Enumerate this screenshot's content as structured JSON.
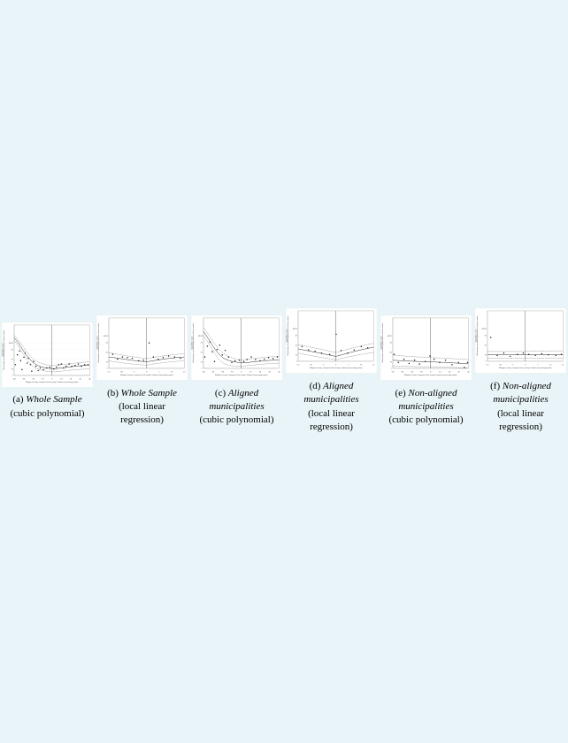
{
  "charts": [
    {
      "id": "a",
      "label_main": "(a) Whole Sample",
      "label_sub": "(cubic polynomial)",
      "x_min": -40,
      "x_max": 40,
      "x_ticks": [
        -40,
        -30,
        -20,
        -10,
        0,
        10,
        20,
        30,
        40
      ],
      "y_label": "Discretionary investment grants per head from counties\n(logarithmic scale)",
      "x_label": "Margin of victory of mayors in last county elections (in percentage point)",
      "type": "wide"
    },
    {
      "id": "b",
      "label_main": "(b) Whole",
      "label_sub": "Sample",
      "label_sub2": "(local linear regression)",
      "x_min": -15,
      "x_max": 15,
      "x_ticks": [
        -15,
        -10,
        -5,
        0,
        5,
        10,
        15
      ],
      "type": "narrow"
    },
    {
      "id": "c",
      "label_main": "(c) Aligned municipalities",
      "label_sub": "(cubic polynomial)",
      "type": "wide"
    },
    {
      "id": "d",
      "label_main": "(d) Aligned municipalities",
      "label_sub": "(local linear regression)",
      "type": "narrow"
    },
    {
      "id": "e",
      "label_main": "(e) Non-aligned municipalities",
      "label_sub": "(cubic polynomial)",
      "type": "wide"
    },
    {
      "id": "f",
      "label_main": "(f) Non-aligned municipalities",
      "label_sub": "(local linear regression)",
      "type": "narrow"
    }
  ],
  "captions": {
    "a_line1": "(a) ",
    "a_italic": "Whole Sample",
    "a_line2": "(cubic polynomial)",
    "b_line1": "(b) ",
    "b_italic": "Whole Sample",
    "b_line2": "(local linear regression)",
    "c_line1": "(c) ",
    "c_italic": "Aligned municipalities",
    "c_line2": "(cubic polynomial)",
    "d_line1": "(d) ",
    "d_italic": "Aligned municipalities",
    "d_line2": "(local linear regression)",
    "e_line1": "(e) ",
    "e_italic": "Non-aligned municipalities",
    "e_line2": "(cubic polynomial)",
    "f_line1": "(f) ",
    "f_italic": "Non-aligned municipalities",
    "f_line2": "(local linear regression)"
  }
}
